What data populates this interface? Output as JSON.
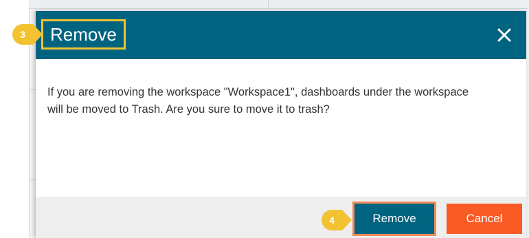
{
  "dialog": {
    "title": "Remove",
    "message": "If you are removing the workspace \"Workspace1\", dashboards under the workspace will be moved to Trash. Are you sure to move it to trash?",
    "close_icon": "close-icon"
  },
  "footer": {
    "remove_label": "Remove",
    "cancel_label": "Cancel"
  },
  "annotations": {
    "step_title": "3",
    "step_remove": "4"
  },
  "colors": {
    "header": "#006480",
    "remove_button": "#006480",
    "cancel_button": "#fa5b24",
    "highlight_title": "#f2c231",
    "highlight_button": "#ef8a57",
    "badge": "#f2c231"
  }
}
